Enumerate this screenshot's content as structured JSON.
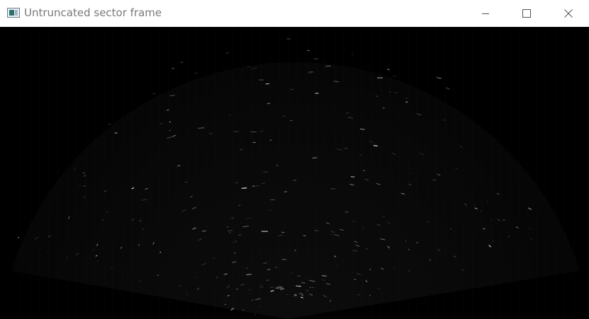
{
  "window": {
    "title": "Untruncated sector frame",
    "icon": "app-window-icon",
    "controls": {
      "minimize_icon": "minimize-icon",
      "maximize_icon": "maximize-icon",
      "close_icon": "close-icon"
    }
  },
  "image": {
    "content": "ultrasound-sector-frame",
    "background_color": "#000000"
  }
}
